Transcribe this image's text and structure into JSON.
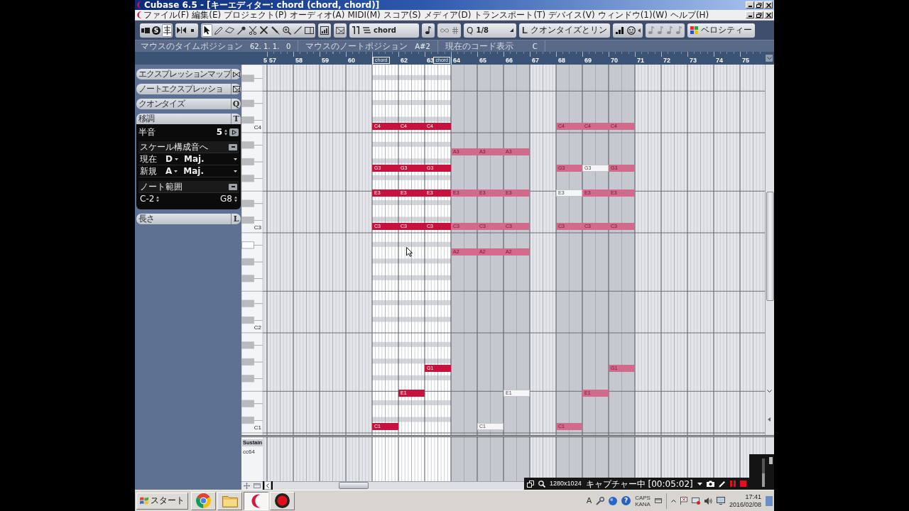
{
  "window": {
    "title": "Cubase 6.5 - [キーエディター: chord (chord, chord)]"
  },
  "menu": [
    "ファイル(F)",
    "編集(E)",
    "プロジェクト(P)",
    "オーディオ(A)",
    "MIDI(M)",
    "スコア(S)",
    "メディア(D)",
    "トランスポート(T)",
    "デバイス(V)",
    "ウィンドウ(1)(W)",
    "ヘルプ(H)"
  ],
  "toolbar": {
    "left_buttons": [
      {
        "on": false
      },
      {
        "label": "S",
        "on": false
      },
      {
        "on": true
      }
    ],
    "tools": [
      {
        "selected": true
      },
      {
        "selected": false
      },
      {
        "selected": false
      },
      {
        "selected": false
      },
      {
        "selected": false
      },
      {
        "selected": false
      },
      {
        "selected": false
      },
      {
        "selected": false
      },
      {
        "selected": false
      },
      {
        "selected": false
      }
    ],
    "part": "chord",
    "quantize": {
      "icon": "Q",
      "value": "1/8"
    },
    "quantize_link": {
      "icon": "L",
      "label": "クオンタイズとリン"
    },
    "velocity": "ベロシティー"
  },
  "info": [
    {
      "label": "マウスのタイムポジション",
      "value": "62. 1. 1.   0"
    },
    {
      "label": "マウスのノートポジション",
      "value": "A#2"
    },
    {
      "label": "現在のコード表示",
      "value": "C"
    }
  ],
  "inspector": {
    "sections": [
      {
        "title": "エクスプレッションマップ",
        "expanded": false
      },
      {
        "title": "ノートエクスプレッショ",
        "expanded": false
      },
      {
        "title": "クオンタイズ",
        "letter": "Q",
        "expanded": false
      },
      {
        "title": "移調",
        "letter": "T",
        "expanded": true,
        "body": {
          "semitone_label": "半音",
          "semitone_value": "5",
          "scale_title": "スケール構成音へ",
          "keys": [
            {
              "label": "現在",
              "key": "D",
              "scale": "Maj."
            },
            {
              "label": "新規",
              "key": "A",
              "scale": "Maj."
            }
          ],
          "range_title": "ノート範囲",
          "range_low": "C-2",
          "range_high": "G8"
        }
      },
      {
        "title": "長さ",
        "letter": "L",
        "expanded": false
      }
    ]
  },
  "bars": [
    {
      "label": "5",
      "part": false
    },
    {
      "label": "57",
      "part": false
    },
    {
      "label": "58",
      "part": false
    },
    {
      "label": "59",
      "part": false
    },
    {
      "label": "60",
      "part": false
    },
    {
      "marker": "chord",
      "part": true,
      "active": true
    },
    {
      "label": "62",
      "part": true,
      "active": true
    },
    {
      "label": "63",
      "end_marker": "chord",
      "part": true,
      "active": true
    },
    {
      "label": "64",
      "part": true,
      "active": false
    },
    {
      "label": "65",
      "part": true,
      "active": false
    },
    {
      "label": "66",
      "part": true,
      "active": false
    },
    {
      "label": "67",
      "part": false
    },
    {
      "label": "68",
      "part": true,
      "active": false
    },
    {
      "label": "69",
      "part": true,
      "active": false
    },
    {
      "label": "70",
      "part": true,
      "active": false
    },
    {
      "label": "71",
      "part": false
    },
    {
      "label": "72",
      "part": false
    },
    {
      "label": "73",
      "part": false
    },
    {
      "label": "74",
      "part": false
    },
    {
      "label": "75",
      "part": false
    }
  ],
  "rows": [
    {
      "black_key": false,
      "highlighted": false
    },
    {
      "black_key": true,
      "highlighted": false
    },
    {
      "black_key": false,
      "highlighted": false
    },
    {
      "black_key": false,
      "highlighted": false
    },
    {
      "black_key": true,
      "highlighted": false
    },
    {
      "black_key": false,
      "highlighted": false
    },
    {
      "black_key": true,
      "highlighted": false
    },
    {
      "black_key": false,
      "highlighted": false,
      "label": "C4",
      "notes": [
        {
          "kind": "none"
        },
        {
          "kind": "none"
        },
        {
          "kind": "none"
        },
        {
          "kind": "none"
        },
        {
          "kind": "none"
        },
        {
          "kind": "active",
          "label": "C4"
        },
        {
          "kind": "active",
          "label": "C4"
        },
        {
          "kind": "active",
          "label": "C4"
        },
        {
          "kind": "none"
        },
        {
          "kind": "none"
        },
        {
          "kind": "none"
        },
        {
          "kind": "none"
        },
        {
          "kind": "inactive",
          "label": "C4"
        },
        {
          "kind": "inactive",
          "label": "C4"
        },
        {
          "kind": "inactive",
          "label": "C4"
        }
      ]
    },
    {
      "black_key": false,
      "highlighted": false
    },
    {
      "black_key": true,
      "highlighted": false
    },
    {
      "black_key": false,
      "highlighted": false,
      "notes": [
        {
          "kind": "none"
        },
        {
          "kind": "none"
        },
        {
          "kind": "none"
        },
        {
          "kind": "none"
        },
        {
          "kind": "none"
        },
        {
          "kind": "none"
        },
        {
          "kind": "none"
        },
        {
          "kind": "none"
        },
        {
          "kind": "inactive",
          "label": "A3"
        },
        {
          "kind": "inactive",
          "label": "A3"
        },
        {
          "kind": "inactive",
          "label": "A3"
        }
      ]
    },
    {
      "black_key": true,
      "highlighted": false
    },
    {
      "black_key": false,
      "highlighted": false,
      "notes": [
        {
          "kind": "none"
        },
        {
          "kind": "none"
        },
        {
          "kind": "none"
        },
        {
          "kind": "none"
        },
        {
          "kind": "none"
        },
        {
          "kind": "active",
          "label": "G3"
        },
        {
          "kind": "active",
          "label": "G3"
        },
        {
          "kind": "active",
          "label": "G3"
        },
        {
          "kind": "none"
        },
        {
          "kind": "none"
        },
        {
          "kind": "none"
        },
        {
          "kind": "none"
        },
        {
          "kind": "inactive",
          "label": "G3"
        },
        {
          "kind": "muted",
          "label": "G3"
        },
        {
          "kind": "inactive",
          "label": "G3"
        }
      ]
    },
    {
      "black_key": true,
      "highlighted": false
    },
    {
      "black_key": false,
      "highlighted": false
    },
    {
      "black_key": false,
      "highlighted": false,
      "notes": [
        {
          "kind": "none"
        },
        {
          "kind": "none"
        },
        {
          "kind": "none"
        },
        {
          "kind": "none"
        },
        {
          "kind": "none"
        },
        {
          "kind": "active",
          "label": "E3"
        },
        {
          "kind": "active",
          "label": "E3"
        },
        {
          "kind": "active",
          "label": "E3"
        },
        {
          "kind": "inactive",
          "label": "E3"
        },
        {
          "kind": "inactive",
          "label": "E3"
        },
        {
          "kind": "inactive",
          "label": "E3"
        },
        {
          "kind": "none"
        },
        {
          "kind": "muted",
          "label": "E3"
        },
        {
          "kind": "inactive",
          "label": "E3"
        },
        {
          "kind": "inactive",
          "label": "E3"
        }
      ]
    },
    {
      "black_key": true,
      "highlighted": false
    },
    {
      "black_key": false,
      "highlighted": false
    },
    {
      "black_key": true,
      "highlighted": false
    },
    {
      "black_key": false,
      "highlighted": false,
      "label": "C3",
      "notes": [
        {
          "kind": "none"
        },
        {
          "kind": "none"
        },
        {
          "kind": "none"
        },
        {
          "kind": "none"
        },
        {
          "kind": "none"
        },
        {
          "kind": "active",
          "label": "C3"
        },
        {
          "kind": "active",
          "label": "C3"
        },
        {
          "kind": "active",
          "label": "C3"
        },
        {
          "kind": "inactive",
          "label": "C3"
        },
        {
          "kind": "inactive",
          "label": "C3"
        },
        {
          "kind": "inactive",
          "label": "C3"
        },
        {
          "kind": "none"
        },
        {
          "kind": "inactive",
          "label": "C3"
        },
        {
          "kind": "inactive",
          "label": "C3"
        },
        {
          "kind": "inactive",
          "label": "C3"
        }
      ]
    },
    {
      "black_key": false,
      "highlighted": false
    },
    {
      "black_key": true,
      "highlighted": true
    },
    {
      "black_key": false,
      "highlighted": false,
      "notes": [
        {
          "kind": "none"
        },
        {
          "kind": "none"
        },
        {
          "kind": "none"
        },
        {
          "kind": "none"
        },
        {
          "kind": "none"
        },
        {
          "kind": "none"
        },
        {
          "kind": "none"
        },
        {
          "kind": "none"
        },
        {
          "kind": "inactive",
          "label": "A2"
        },
        {
          "kind": "inactive",
          "label": "A2"
        },
        {
          "kind": "inactive",
          "label": "A2"
        }
      ]
    },
    {
      "black_key": true,
      "highlighted": false
    },
    {
      "black_key": false,
      "highlighted": false
    },
    {
      "black_key": true,
      "highlighted": false
    },
    {
      "black_key": false,
      "highlighted": false
    },
    {
      "black_key": false,
      "highlighted": false
    },
    {
      "black_key": true,
      "highlighted": false
    },
    {
      "black_key": false,
      "highlighted": false
    },
    {
      "black_key": true,
      "highlighted": false
    },
    {
      "black_key": false,
      "highlighted": false,
      "label": "C2"
    },
    {
      "black_key": false,
      "highlighted": false
    },
    {
      "black_key": true,
      "highlighted": false
    },
    {
      "black_key": false,
      "highlighted": false
    },
    {
      "black_key": true,
      "highlighted": false
    },
    {
      "black_key": false,
      "highlighted": false,
      "notes": [
        {
          "kind": "none"
        },
        {
          "kind": "none"
        },
        {
          "kind": "none"
        },
        {
          "kind": "none"
        },
        {
          "kind": "none"
        },
        {
          "kind": "none"
        },
        {
          "kind": "none"
        },
        {
          "kind": "active",
          "label": "G1"
        },
        {
          "kind": "none"
        },
        {
          "kind": "none"
        },
        {
          "kind": "none"
        },
        {
          "kind": "none"
        },
        {
          "kind": "none"
        },
        {
          "kind": "none"
        },
        {
          "kind": "inactive",
          "label": "G1"
        }
      ]
    },
    {
      "black_key": true,
      "highlighted": false
    },
    {
      "black_key": false,
      "highlighted": false
    },
    {
      "black_key": false,
      "highlighted": false,
      "notes": [
        {
          "kind": "none"
        },
        {
          "kind": "none"
        },
        {
          "kind": "none"
        },
        {
          "kind": "none"
        },
        {
          "kind": "none"
        },
        {
          "kind": "none"
        },
        {
          "kind": "active",
          "label": "E1"
        },
        {
          "kind": "none"
        },
        {
          "kind": "none"
        },
        {
          "kind": "none"
        },
        {
          "kind": "muted",
          "label": "E1"
        },
        {
          "kind": "none"
        },
        {
          "kind": "none"
        },
        {
          "kind": "inactive",
          "label": "E1"
        }
      ]
    },
    {
      "black_key": true,
      "highlighted": false
    },
    {
      "black_key": false,
      "highlighted": false
    },
    {
      "black_key": true,
      "highlighted": false
    },
    {
      "black_key": false,
      "highlighted": false,
      "label": "C1",
      "notes": [
        {
          "kind": "none"
        },
        {
          "kind": "none"
        },
        {
          "kind": "none"
        },
        {
          "kind": "none"
        },
        {
          "kind": "none"
        },
        {
          "kind": "active",
          "label": "C1"
        },
        {
          "kind": "none"
        },
        {
          "kind": "none"
        },
        {
          "kind": "none"
        },
        {
          "kind": "muted",
          "label": "C1"
        },
        {
          "kind": "none"
        },
        {
          "kind": "none"
        },
        {
          "kind": "inactive",
          "label": "C1"
        }
      ]
    },
    {
      "black_key": false,
      "highlighted": false
    }
  ],
  "controller": {
    "name": "Sustain",
    "cc": "cc64"
  },
  "taskbar": {
    "start": "スタート",
    "apps": [
      {
        "selected": false
      },
      {
        "selected": false
      },
      {
        "selected": true
      },
      {
        "selected": false
      }
    ],
    "tray": {
      "ime": "A",
      "help": "?",
      "caps": "CAPS",
      "kana": "KANA",
      "time": "17:41",
      "date": "2016/02/08"
    }
  },
  "recorder": {
    "resolution": "1280x1024",
    "status": "キャプチャー中 [00:05:02]"
  }
}
